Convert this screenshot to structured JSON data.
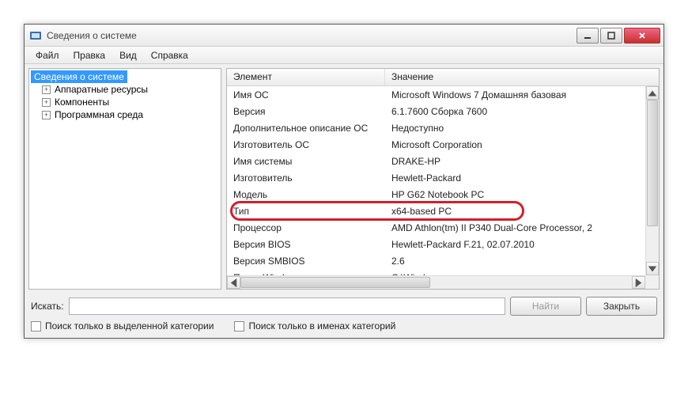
{
  "window": {
    "title": "Сведения о системе"
  },
  "menu": {
    "file": "Файл",
    "edit": "Правка",
    "view": "Вид",
    "help": "Справка"
  },
  "tree": {
    "root": "Сведения о системе",
    "items": [
      "Аппаратные ресурсы",
      "Компоненты",
      "Программная среда"
    ]
  },
  "columns": {
    "element": "Элемент",
    "value": "Значение"
  },
  "rows": [
    {
      "elem": "Имя ОС",
      "val": "Microsoft Windows 7 Домашняя базовая"
    },
    {
      "elem": "Версия",
      "val": "6.1.7600 Сборка 7600"
    },
    {
      "elem": "Дополнительное описание ОС",
      "val": "Недоступно"
    },
    {
      "elem": "Изготовитель ОС",
      "val": "Microsoft Corporation"
    },
    {
      "elem": "Имя системы",
      "val": "DRAKE-HP"
    },
    {
      "elem": "Изготовитель",
      "val": "Hewlett-Packard"
    },
    {
      "elem": "Модель",
      "val": "HP G62 Notebook PC"
    },
    {
      "elem": "Тип",
      "val": "x64-based PC",
      "highlight": true
    },
    {
      "elem": "Процессор",
      "val": "AMD Athlon(tm) II P340 Dual-Core Processor, 2"
    },
    {
      "elem": "Версия BIOS",
      "val": "Hewlett-Packard F.21, 02.07.2010"
    },
    {
      "elem": "Версия SMBIOS",
      "val": "2.6"
    },
    {
      "elem": "Папка Windows",
      "val": "C:\\Windows"
    }
  ],
  "search": {
    "label": "Искать:",
    "find": "Найти",
    "close": "Закрыть",
    "only_category": "Поиск только в выделенной категории",
    "only_names": "Поиск только в именах категорий"
  }
}
